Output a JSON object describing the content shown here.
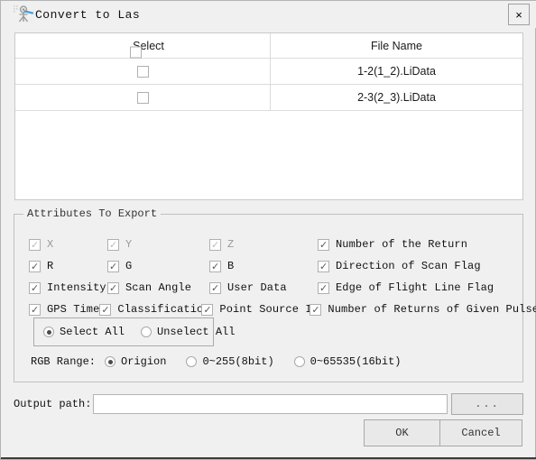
{
  "window": {
    "title": "Convert to Las",
    "icon": "lidar-scanner-icon",
    "close_label": "×"
  },
  "file_table": {
    "columns": [
      "Select",
      "File Name"
    ],
    "header_checkbox_checked": false,
    "rows": [
      {
        "selected": false,
        "file_name": "1-2(1_2).LiData"
      },
      {
        "selected": false,
        "file_name": "2-3(2_3).LiData"
      }
    ]
  },
  "attributes_group": {
    "legend": "Attributes To Export",
    "items": [
      {
        "label": "X",
        "checked": true,
        "disabled": true
      },
      {
        "label": "Y",
        "checked": true,
        "disabled": true
      },
      {
        "label": "Z",
        "checked": true,
        "disabled": true
      },
      {
        "label": "Number of the Return",
        "checked": true,
        "disabled": false
      },
      {
        "label": "R",
        "checked": true,
        "disabled": false
      },
      {
        "label": "G",
        "checked": true,
        "disabled": false
      },
      {
        "label": "B",
        "checked": true,
        "disabled": false
      },
      {
        "label": "Direction of Scan Flag",
        "checked": true,
        "disabled": false
      },
      {
        "label": "Intensity",
        "checked": true,
        "disabled": false
      },
      {
        "label": "Scan Angle",
        "checked": true,
        "disabled": false
      },
      {
        "label": "User Data",
        "checked": true,
        "disabled": false
      },
      {
        "label": "Edge of Flight Line Flag",
        "checked": true,
        "disabled": false
      },
      {
        "label": "GPS Time",
        "checked": true,
        "disabled": false
      },
      {
        "label": "Classification",
        "checked": true,
        "disabled": false
      },
      {
        "label": "Point Source ID",
        "checked": true,
        "disabled": false
      },
      {
        "label": "Number of Returns of Given Pulse",
        "checked": true,
        "disabled": false
      }
    ],
    "select_toggle": {
      "options": [
        "Select All",
        "Unselect All"
      ],
      "selected": "Select All"
    },
    "rgb_range": {
      "label": "RGB Range:",
      "options": [
        "Origion",
        "0~255(8bit)",
        "0~65535(16bit)"
      ],
      "selected": "Origion"
    }
  },
  "output": {
    "label": "Output path:",
    "value": "",
    "placeholder": "",
    "browse_label": "..."
  },
  "buttons": {
    "ok": "OK",
    "cancel": "Cancel"
  },
  "colors": {
    "dialog_bg": "#f0f0f0",
    "table_bg": "#ffffff",
    "border": "#c0c0c0",
    "icon_accent": "#4d9fd6"
  }
}
